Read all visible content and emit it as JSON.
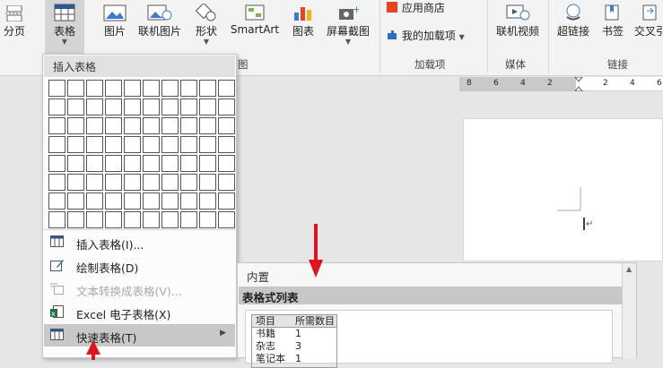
{
  "ribbon": {
    "buttons": {
      "page_break": "分页",
      "table": "表格",
      "pictures": "图片",
      "online_pictures": "联机图片",
      "shapes": "形状",
      "smartart": "SmartArt",
      "chart": "图表",
      "screenshot": "屏幕截图",
      "store": "应用商店",
      "my_addins": "我的加载项",
      "online_video": "联机视频",
      "hyperlink": "超链接",
      "bookmark": "书签",
      "cross_ref": "交叉引"
    },
    "groups": {
      "illustrations_tail": "图",
      "addins": "加载项",
      "media": "媒体",
      "links": "链接"
    }
  },
  "ruler": {
    "labels": [
      "8",
      "6",
      "4",
      "2",
      "2",
      "4",
      "6"
    ]
  },
  "insert_table_menu": {
    "title": "插入表格",
    "grid": {
      "columns": 10,
      "rows": 8
    },
    "items": [
      {
        "label": "插入表格(I)...",
        "icon": "table-icon",
        "enabled": true
      },
      {
        "label": "绘制表格(D)",
        "icon": "pencil-table-icon",
        "enabled": true
      },
      {
        "label": "文本转换成表格(V)...",
        "icon": "text-to-table-icon",
        "enabled": false
      },
      {
        "label": "Excel 电子表格(X)",
        "icon": "excel-icon",
        "enabled": true
      },
      {
        "label": "快速表格(T)",
        "icon": "quick-table-icon",
        "enabled": true,
        "submenu": true,
        "highlighted": true
      }
    ]
  },
  "quick_tables_gallery": {
    "section": "内置",
    "category": "表格式列表",
    "preview": {
      "headers": [
        "项目",
        "所需数目"
      ],
      "rows": [
        [
          "书籍",
          "1"
        ],
        [
          "杂志",
          "3"
        ],
        [
          "笔记本",
          "1"
        ]
      ]
    }
  },
  "colors": {
    "annotation_arrow": "#e0141e",
    "excel_green": "#1e7145",
    "store_red": "#e8421f",
    "addin_blue": "#2b6cc4"
  }
}
